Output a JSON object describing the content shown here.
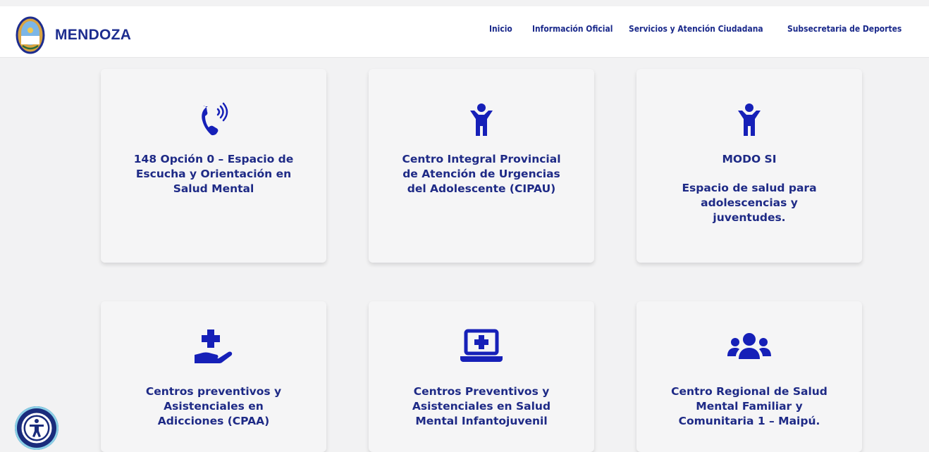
{
  "header": {
    "brand": "MENDOZA",
    "nav": [
      {
        "label": "Inicio"
      },
      {
        "label": "Información Oficial"
      },
      {
        "label": "Servicios y Atención Ciudadana"
      },
      {
        "label": "Subsecretaria de Deportes"
      }
    ]
  },
  "cards": [
    {
      "icon": "phone-volume-icon",
      "lines": [
        "148 Opción 0 – Espacio de Escucha y Orientación en Salud Mental"
      ]
    },
    {
      "icon": "child-icon",
      "lines": [
        "Centro Integral Provincial de Atención de Urgencias del Adolescente (CIPAU)"
      ]
    },
    {
      "icon": "child-icon",
      "lines": [
        "MODO SI",
        "Espacio de salud para adolescencias y juventudes."
      ]
    },
    {
      "icon": "hand-holding-medical-icon",
      "lines": [
        "Centros preventivos y Asistenciales en Adicciones (CPAA)"
      ]
    },
    {
      "icon": "laptop-medical-icon",
      "lines": [
        "Centros Preventivos y Asistenciales en Salud Mental Infantojuvenil"
      ]
    },
    {
      "icon": "users-icon",
      "lines": [
        "Centro Regional de Salud Mental Familiar y Comunitaria 1 – Maipú."
      ]
    }
  ],
  "colors": {
    "brand": "#1d2d8f",
    "icon": "#1620b8",
    "background": "#f2f2f3"
  },
  "accessibility_button": {
    "icon": "accessibility-icon"
  }
}
